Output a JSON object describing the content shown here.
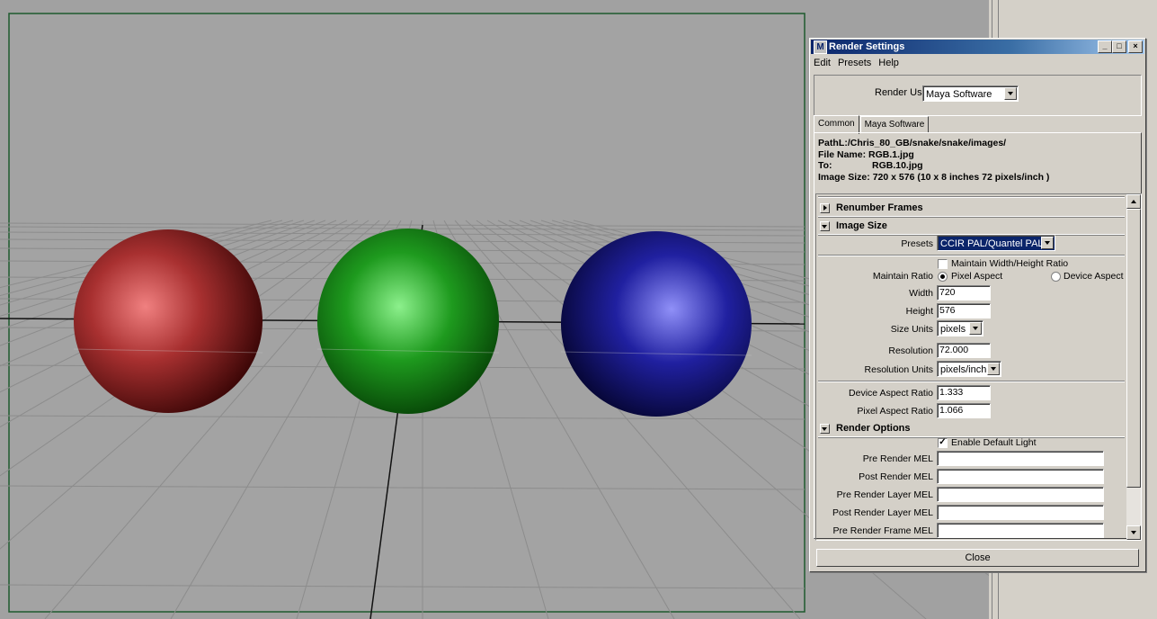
{
  "window": {
    "title": "Render Settings",
    "app_icon": "M",
    "controls": {
      "minimize": "_",
      "maximize": "□",
      "close": "×"
    }
  },
  "menu": [
    "Edit",
    "Presets",
    "Help"
  ],
  "render_using": {
    "label": "Render Using",
    "value": "Maya Software"
  },
  "tabs": [
    "Common",
    "Maya Software"
  ],
  "info": {
    "path_label": "Path:",
    "path": "L:/Chris_80_GB/snake/snake/images/",
    "file_name_label": "File Name:",
    "file_name": "RGB.1.jpg",
    "to_label": "To:",
    "to": "RGB.10.jpg",
    "image_size_label": "Image Size:",
    "image_size": "720 x 576 (10 x 8 inches 72 pixels/inch )"
  },
  "sections": {
    "renumber_frames": "Renumber Frames",
    "image_size": "Image Size",
    "render_options": "Render Options"
  },
  "image_size": {
    "presets_label": "Presets",
    "presets_value": "CCIR PAL/Quantel PAL",
    "maintain_wh_label": "Maintain Width/Height Ratio",
    "maintain_ratio_label": "Maintain Ratio",
    "pixel_aspect_label": "Pixel Aspect",
    "device_aspect_label": "Device Aspect",
    "width_label": "Width",
    "width": "720",
    "height_label": "Height",
    "height": "576",
    "size_units_label": "Size Units",
    "size_units": "pixels",
    "resolution_label": "Resolution",
    "resolution": "72.000",
    "resolution_units_label": "Resolution Units",
    "resolution_units": "pixels/inch",
    "device_aspect_ratio_label": "Device Aspect Ratio",
    "device_aspect_ratio": "1.333",
    "pixel_aspect_ratio_label": "Pixel Aspect Ratio",
    "pixel_aspect_ratio": "1.066"
  },
  "render_options": {
    "enable_default_light_label": "Enable Default Light",
    "check": "✓",
    "pre_render_mel": "Pre Render MEL",
    "post_render_mel": "Post Render MEL",
    "pre_render_layer_mel": "Pre Render Layer MEL",
    "post_render_layer_mel": "Post Render Layer MEL",
    "pre_render_frame_mel": "Pre Render Frame MEL"
  },
  "close_button": "Close"
}
